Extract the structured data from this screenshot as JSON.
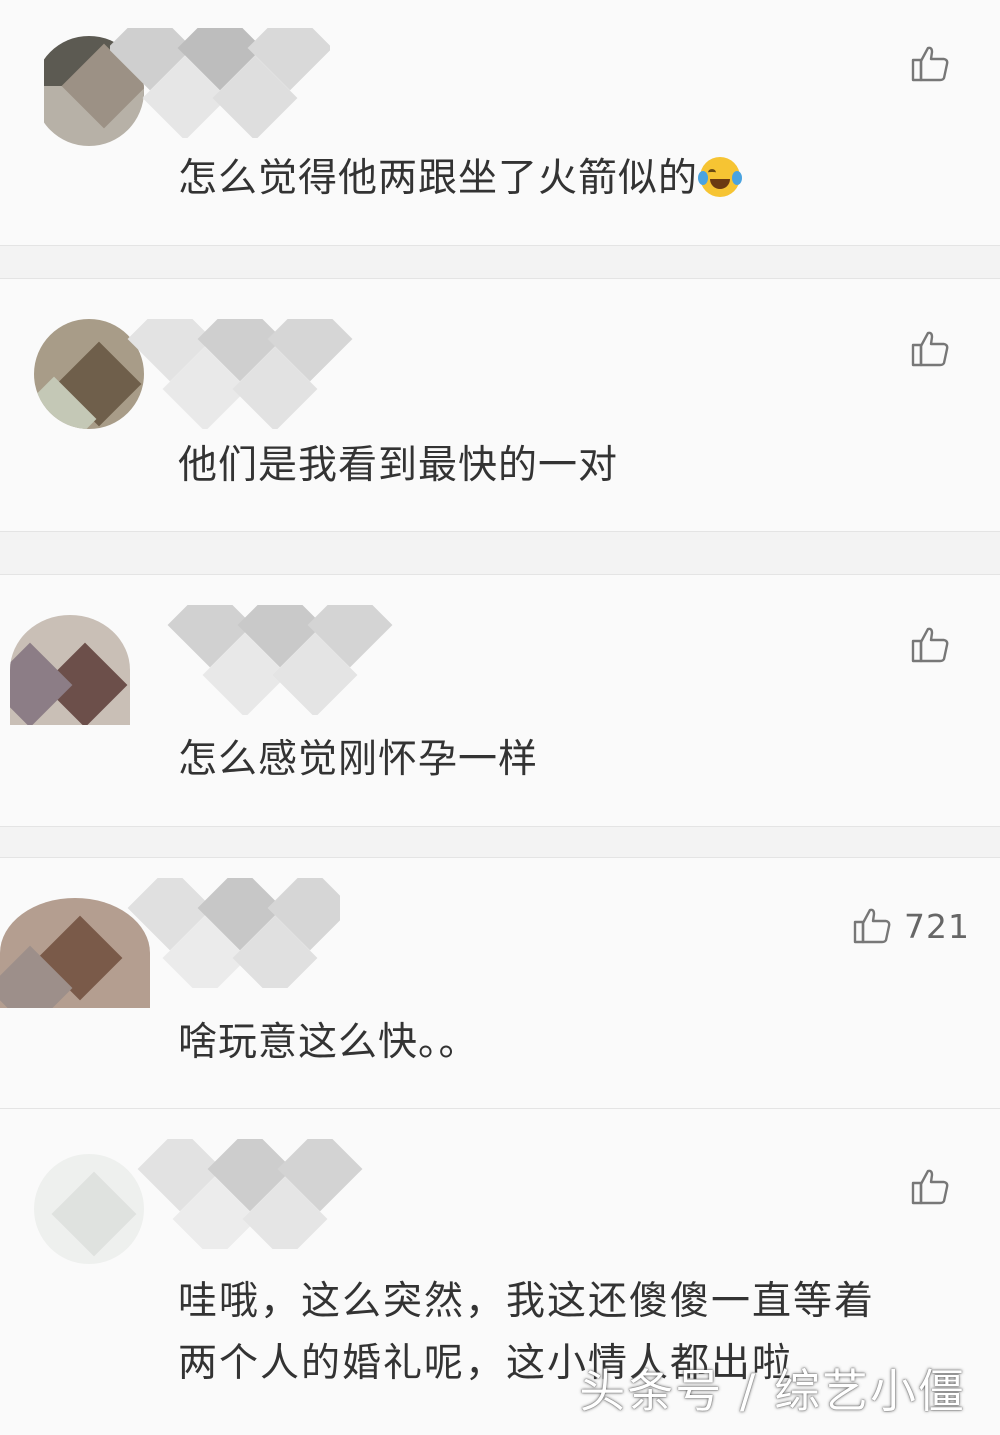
{
  "comments": [
    {
      "text": "怎么觉得他两跟坐了火箭似的",
      "emoji": "laughing-crying-emoji",
      "likes": ""
    },
    {
      "text": "他们是我看到最快的一对",
      "likes": ""
    },
    {
      "text": "怎么感觉刚怀孕一样",
      "likes": ""
    },
    {
      "text": "啥玩意这么快。。",
      "likes": "721"
    },
    {
      "text_line1": "哇哦，这么突然，我这还傻傻一直等着",
      "text_line2": "两个人的婚礼呢，这小情人都出啦",
      "likes": ""
    }
  ],
  "icons": {
    "like": "thumbs-up-icon"
  },
  "watermark": "头条号 / 综艺小僵",
  "colors": {
    "background": "#fafafa",
    "text": "#333333",
    "icon": "#777777"
  }
}
